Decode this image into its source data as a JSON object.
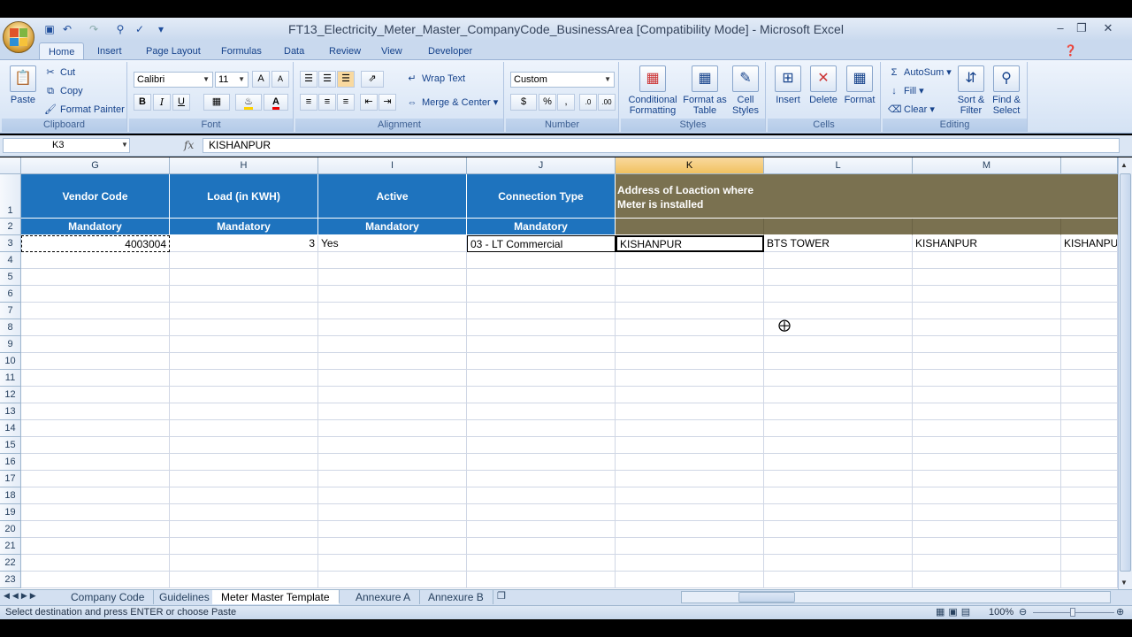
{
  "window": {
    "title": "FT13_Electricity_Meter_Master_CompanyCode_BusinessArea  [Compatibility Mode] - Microsoft Excel"
  },
  "ribbon_tabs": [
    "Home",
    "Insert",
    "Page Layout",
    "Formulas",
    "Data",
    "Review",
    "View",
    "Developer"
  ],
  "clipboard": {
    "paste": "Paste",
    "cut": "Cut",
    "copy": "Copy",
    "format_painter": "Format Painter",
    "label": "Clipboard"
  },
  "font": {
    "name": "Calibri",
    "size": "11",
    "bold": "B",
    "italic": "I",
    "underline": "U",
    "label": "Font"
  },
  "alignment": {
    "wrap_text": "Wrap Text",
    "merge_center": "Merge & Center",
    "label": "Alignment"
  },
  "number": {
    "format": "Custom",
    "currency": "$",
    "percent": "%",
    "comma": ",",
    "label": "Number"
  },
  "styles": {
    "conditional": "Conditional Formatting",
    "format_table": "Format as Table",
    "cell_styles": "Cell Styles",
    "label": "Styles"
  },
  "cells": {
    "insert": "Insert",
    "delete": "Delete",
    "format": "Format",
    "label": "Cells"
  },
  "editing": {
    "autosum": "AutoSum",
    "fill": "Fill",
    "clear": "Clear",
    "sort_filter": "Sort & Filter",
    "find_select": "Find & Select",
    "label": "Editing"
  },
  "formula_bar": {
    "name_box": "K3",
    "fx": "fx",
    "content": "KISHANPUR"
  },
  "columns": [
    "G",
    "H",
    "I",
    "J",
    "K",
    "L",
    "M"
  ],
  "rows": [
    "1",
    "2",
    "3",
    "4",
    "5",
    "6",
    "7",
    "8",
    "9",
    "10",
    "11",
    "12",
    "13",
    "14",
    "15",
    "16",
    "17",
    "18",
    "19",
    "20",
    "21",
    "22",
    "23"
  ],
  "sheet": {
    "header_row1": [
      "Vendor Code",
      "Load (in KWH)",
      "Active",
      "Connection Type",
      "Address of Loaction where Meter is installed"
    ],
    "header_row2": [
      "Mandatory",
      "Mandatory",
      "Mandatory",
      "Mandatory"
    ],
    "data_row3": [
      "4003004",
      "3",
      "Yes",
      "03 - LT Commercial",
      "KISHANPUR",
      "BTS TOWER",
      "KISHANPUR",
      "KISHANPU"
    ]
  },
  "sheet_tabs": [
    "Company Code",
    "Guidelines",
    "Meter Master Template",
    "Annexure A",
    "Annexure B"
  ],
  "status": {
    "message": "Select destination and press ENTER or choose Paste",
    "zoom": "100%"
  },
  "colors": {
    "header_blue": "#1e73be",
    "header_olive": "#7a7150",
    "selected_col": "#f1c15f"
  }
}
